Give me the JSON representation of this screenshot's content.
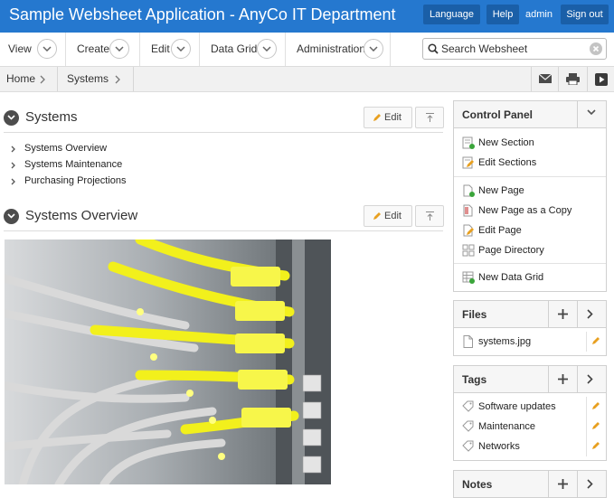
{
  "header": {
    "app_title": "Sample Websheet Application - AnyCo IT Department",
    "language_label": "Language",
    "help_label": "Help",
    "user": "admin",
    "signout_label": "Sign out"
  },
  "menu": {
    "items": [
      {
        "label": "View"
      },
      {
        "label": "Create"
      },
      {
        "label": "Edit"
      },
      {
        "label": "Data Grid"
      },
      {
        "label": "Administration"
      }
    ]
  },
  "search": {
    "placeholder": "Search Websheet"
  },
  "breadcrumb": {
    "items": [
      {
        "label": "Home"
      },
      {
        "label": "Systems"
      }
    ]
  },
  "toolbar": {
    "icons": [
      "mail-icon",
      "print-icon",
      "play-icon"
    ]
  },
  "sections": [
    {
      "title": "Systems",
      "edit_label": "Edit",
      "links": [
        {
          "label": "Systems Overview"
        },
        {
          "label": "Systems Maintenance"
        },
        {
          "label": "Purchasing Projections"
        }
      ]
    },
    {
      "title": "Systems Overview",
      "edit_label": "Edit"
    }
  ],
  "control_panel": {
    "title": "Control Panel",
    "items": [
      {
        "label": "New Section",
        "icon": "new-section-icon"
      },
      {
        "label": "Edit Sections",
        "icon": "edit-sections-icon"
      },
      {
        "label": "New Page",
        "icon": "new-page-icon"
      },
      {
        "label": "New Page as a Copy",
        "icon": "copy-page-icon"
      },
      {
        "label": "Edit Page",
        "icon": "edit-page-icon"
      },
      {
        "label": "Page Directory",
        "icon": "page-directory-icon"
      },
      {
        "label": "New Data Grid",
        "icon": "new-data-grid-icon"
      }
    ]
  },
  "files": {
    "title": "Files",
    "items": [
      {
        "label": "systems.jpg"
      }
    ]
  },
  "tags": {
    "title": "Tags",
    "items": [
      {
        "label": "Software updates"
      },
      {
        "label": "Maintenance"
      },
      {
        "label": "Networks"
      }
    ]
  },
  "notes": {
    "title": "Notes"
  },
  "colors": {
    "header_blue": "#2578cf",
    "header_button": "#1a5fa8",
    "cable_yellow": "#f2f01c",
    "pencil_orange": "#e8a020",
    "add_green": "#3aa53a"
  }
}
